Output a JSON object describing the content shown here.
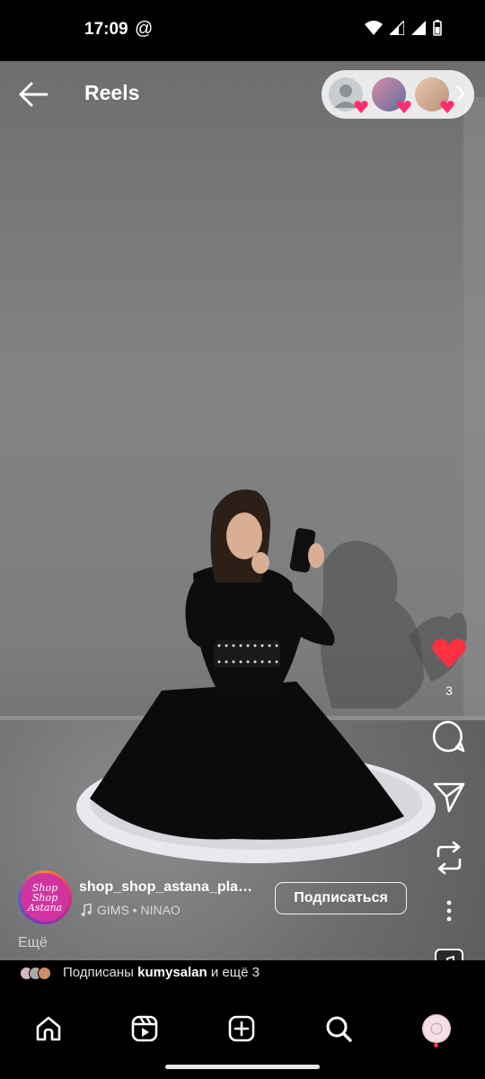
{
  "status_bar": {
    "time": "17:09",
    "at_symbol": "@"
  },
  "header": {
    "title": "Reels"
  },
  "actions": {
    "like_count": "3"
  },
  "reel": {
    "account_name": "shop_shop_astana_pla…",
    "avatar_text": [
      "Shop",
      "Shop",
      "Astana"
    ],
    "music": "GIMS • NINAO",
    "subscribe_label": "Подписаться",
    "more_label": "Ещё"
  },
  "followed": {
    "prefix": "Подписаны",
    "username": "kumysalan",
    "suffix": "и ещё 3"
  },
  "colors": {
    "like_heart": "#ff3040",
    "pill_heart": "#ff2d6f",
    "subscribe_border": "#ffffff",
    "notification_dot": "#ff2d55"
  },
  "icons": {
    "status": [
      "wifi-icon",
      "cell-signal-icon",
      "battery-icon"
    ],
    "rail": [
      "heart-icon",
      "comment-icon",
      "share-icon",
      "remix-icon",
      "more-icon"
    ],
    "nav": [
      "home-icon",
      "reels-icon",
      "create-icon",
      "search-icon",
      "profile-avatar"
    ]
  }
}
